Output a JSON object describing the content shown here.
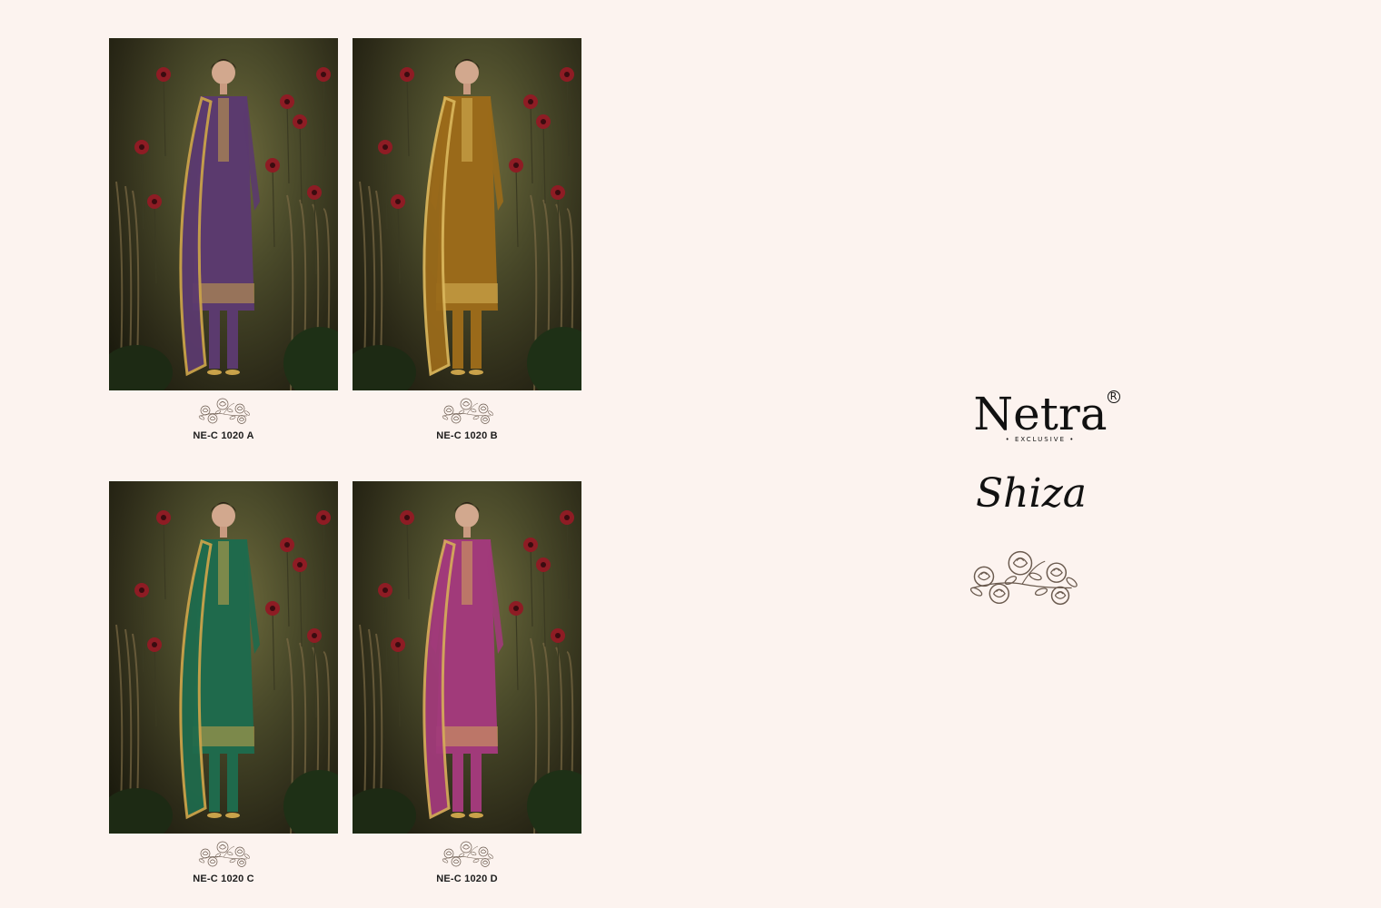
{
  "brand": {
    "name": "Netra",
    "registered_mark": "R",
    "tagline": "• EXCLUSIVE •",
    "collection": "Shiza"
  },
  "products": [
    {
      "code": "NE-C 1020 A",
      "color_name": "purple",
      "outfit_color": "#5b3a6e",
      "accent_color": "#c9a24a"
    },
    {
      "code": "NE-C 1020 B",
      "color_name": "mustard",
      "outfit_color": "#9a6a1a",
      "accent_color": "#d8b45a"
    },
    {
      "code": "NE-C 1020 C",
      "color_name": "green",
      "outfit_color": "#1f6a4c",
      "accent_color": "#c9a24a"
    },
    {
      "code": "NE-C 1020 D",
      "color_name": "magenta",
      "outfit_color": "#a13a7a",
      "accent_color": "#d4a85a"
    }
  ],
  "colors": {
    "background": "#fcf3ef",
    "text": "#111111",
    "rose_outline": "#6a5a4e"
  },
  "icons": {
    "rose_decoration": "rose-cluster-icon"
  }
}
